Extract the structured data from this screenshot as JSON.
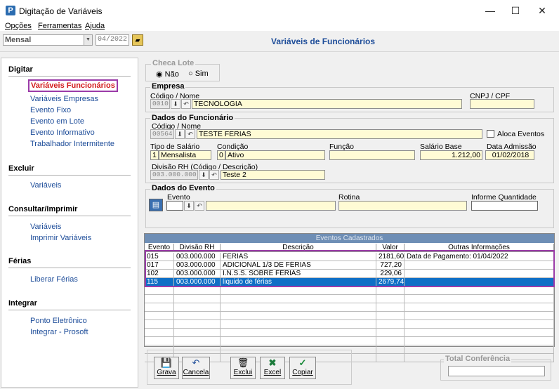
{
  "window": {
    "title": "Digitação de Variáveis",
    "minimize": "—",
    "maximize": "☐",
    "close": "✕",
    "icon_letter": "P"
  },
  "menu": {
    "items": [
      "Opções",
      "Ferramentas",
      "Ajuda"
    ]
  },
  "toolbar": {
    "period": "Mensal",
    "date": "04/2022",
    "folder_icon": "folder-icon"
  },
  "page": {
    "title": "Variáveis de Funcionários"
  },
  "sidebar": {
    "digitar": {
      "title": "Digitar",
      "items": [
        "Variáveis Funcionários",
        "Variáveis Empresas",
        "Evento Fixo",
        "Evento em Lote",
        "Evento Informativo",
        "Trabalhador Intermitente"
      ]
    },
    "excluir": {
      "title": "Excluir",
      "items": [
        "Variáveis"
      ]
    },
    "consultar": {
      "title": "Consultar/Imprimir",
      "items": [
        "Variáveis",
        "Imprimir Variáveis"
      ]
    },
    "ferias": {
      "title": "Férias",
      "items": [
        "Liberar Férias"
      ]
    },
    "integrar": {
      "title": "Integrar",
      "items": [
        "Ponto Eletrônico",
        "Integrar - Prosoft"
      ]
    }
  },
  "checa_lote": {
    "title": "Checa Lote",
    "nao": "Não",
    "sim": "Sim",
    "selected": "Não"
  },
  "empresa": {
    "title": "Empresa",
    "codigo_label": "Código / Nome",
    "codigo": "0010",
    "nome": "TECNOLOGIA",
    "cnpj_label": "CNPJ / CPF",
    "cnpj": ""
  },
  "funcionario": {
    "title": "Dados do Funcionário",
    "codigo_label": "Código / Nome",
    "codigo": "00564",
    "nome": "TESTE FERIAS",
    "aloca_label": "Aloca Eventos",
    "tipo_label": "Tipo de Salário",
    "tipo_code": "1",
    "tipo": "Mensalista",
    "condicao_label": "Condição",
    "condicao_code": "0",
    "condicao": "Ativo",
    "funcao_label": "Função",
    "funcao": "",
    "salario_label": "Salário Base",
    "salario": "1.212,00",
    "admissao_label": "Data Admissão",
    "admissao": "01/02/2018",
    "divisao_label": "Divisão RH (Código / Descrição)",
    "divisao": "003.000.000",
    "divisao_desc": "Teste 2"
  },
  "evento": {
    "title": "Dados do Evento",
    "evento_label": "Evento",
    "rotina_label": "Rotina",
    "quantidade_label": "Informe Quantidade"
  },
  "table": {
    "title": "Eventos Cadastrados",
    "headers": [
      "Evento",
      "Divisão RH",
      "Descrição",
      "Valor",
      "Outras Informações"
    ],
    "rows": [
      [
        "015",
        "003.000.000",
        "FERIAS",
        "2181,60",
        "Data de Pagamento: 01/04/2022"
      ],
      [
        "017",
        "003.000.000",
        "ADICIONAL 1/3 DE FÉRIAS",
        "727,20",
        ""
      ],
      [
        "102",
        "003.000.000",
        "I.N.S.S. SOBRE FÉRIAS",
        "229,06",
        ""
      ],
      [
        "115",
        "003.000.000",
        "liquido de férias",
        "2679,74",
        ""
      ]
    ],
    "selected_row": 3
  },
  "buttons": {
    "grava": "Grava",
    "cancela": "Cancela",
    "exclui": "Exclui",
    "excel": "Excel",
    "copiar": "Copiar"
  },
  "total": {
    "title": "Total Conferência",
    "value": ""
  },
  "colors": {
    "accent": "#1f4e9a",
    "active_link": "#d21a1a",
    "highlight": "#9b3ba8",
    "selected_row": "#0f6fc6",
    "input_bg": "#fffbd5"
  }
}
